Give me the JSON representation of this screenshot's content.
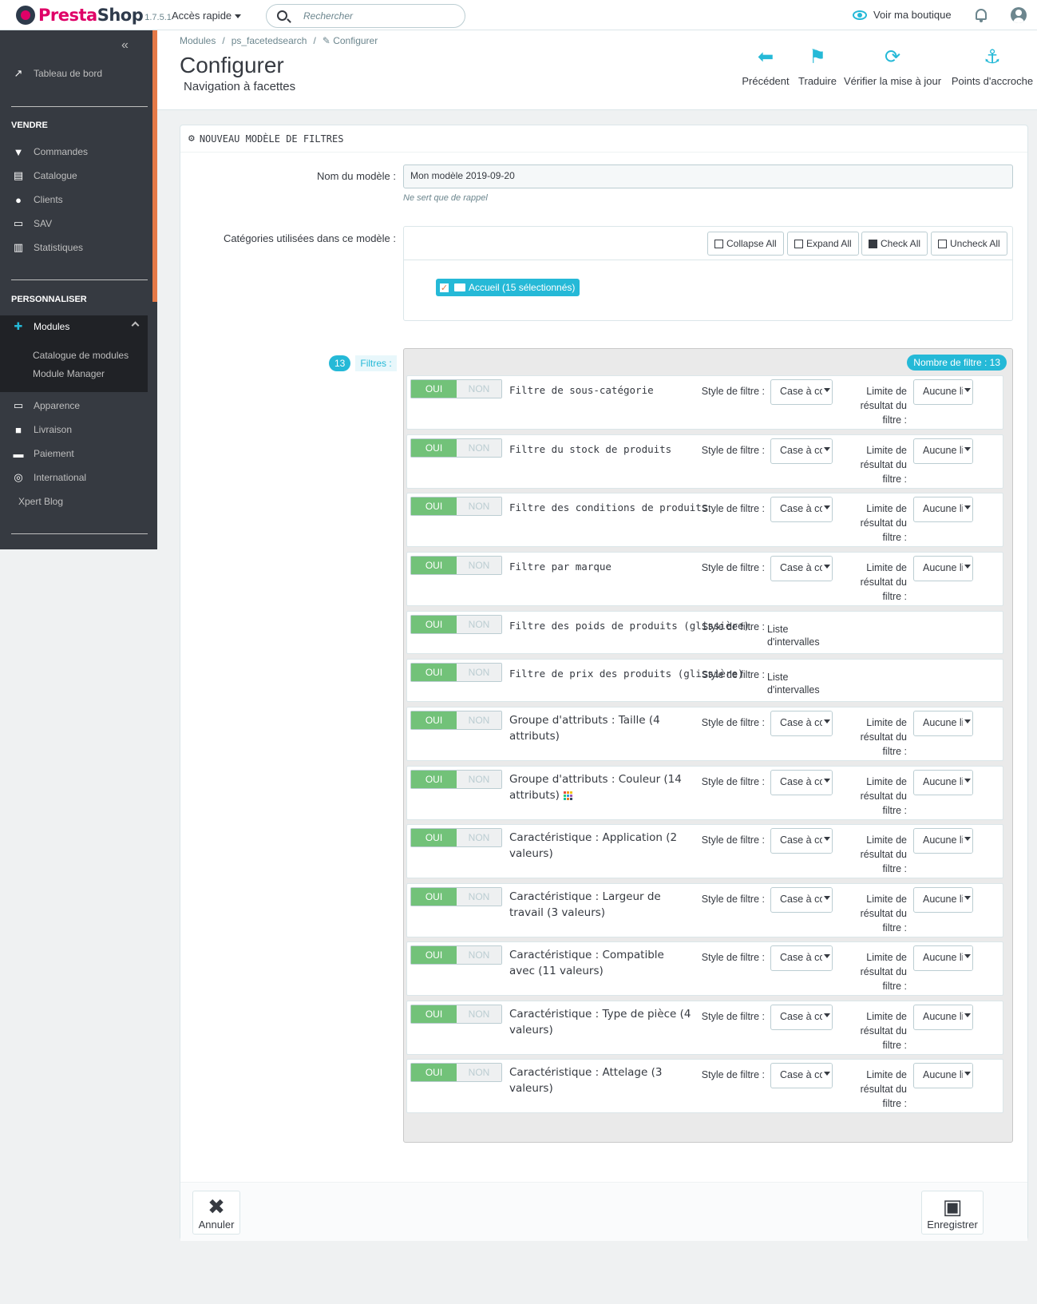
{
  "topbar": {
    "brand_part1": "Presta",
    "brand_part2": "Shop",
    "version": "1.7.5.1",
    "quick_access": "Accès rapide",
    "search_placeholder": "Rechercher",
    "view_shop": "Voir ma boutique"
  },
  "sidebar": {
    "dashboard": "Tableau de bord",
    "section_sell": "VENDRE",
    "orders": "Commandes",
    "catalog": "Catalogue",
    "customers": "Clients",
    "sav": "SAV",
    "stats": "Statistiques",
    "section_customize": "PERSONNALISER",
    "modules": "Modules",
    "modules_catalog": "Catalogue de modules",
    "module_manager": "Module Manager",
    "appearance": "Apparence",
    "shipping": "Livraison",
    "payment": "Paiement",
    "international": "International",
    "xpert_blog": "Xpert Blog"
  },
  "header": {
    "breadcrumb": [
      "Modules",
      "ps_facetedsearch",
      "Configurer"
    ],
    "title": "Configurer",
    "subtitle": "Navigation à facettes",
    "toolbar": [
      "Précédent",
      "Traduire",
      "Vérifier la mise à jour",
      "Points d'accroche"
    ]
  },
  "panel": {
    "heading": "NOUVEAU MODÈLE DE FILTRES",
    "model_name_label": "Nom du modèle :",
    "model_name_value": "Mon modèle 2019-09-20",
    "model_name_help": "Ne sert que de rappel",
    "categories_label": "Catégories utilisées dans ce modèle :",
    "tree_buttons": [
      "Collapse All",
      "Expand All",
      "Check All",
      "Uncheck All"
    ],
    "tree_root": "Accueil (15 sélectionnés)",
    "filters_count": "13",
    "filters_label": "Filtres :",
    "filters_total": "Nombre de filtre : 13",
    "toggle_on": "OUI",
    "toggle_off": "NON",
    "style_label": "Style de filtre :",
    "limit_label": "Limite de résultat du filtre :",
    "style_value": "Case à cocher",
    "limit_value": "Aucune limite",
    "range_value": "Liste d'intervalles",
    "filters": [
      "Filtre de sous-catégorie",
      "Filtre du stock de produits",
      "Filtre des conditions de produits",
      "Filtre par marque",
      "Filtre des poids de produits (glissière)",
      "Filtre de prix des produits (glissière)",
      "Groupe d'attributs : Taille (4 attributs)",
      "Groupe d'attributs : Couleur (14 attributs)",
      "Caractéristique : Application (2 valeurs)",
      "Caractéristique : Largeur de travail (3 valeurs)",
      "Caractéristique : Compatible avec (11 valeurs)",
      "Caractéristique : Type de pièce (4 valeurs)",
      "Caractéristique : Attelage (3 valeurs)"
    ],
    "cancel": "Annuler",
    "save": "Enregistrer"
  }
}
